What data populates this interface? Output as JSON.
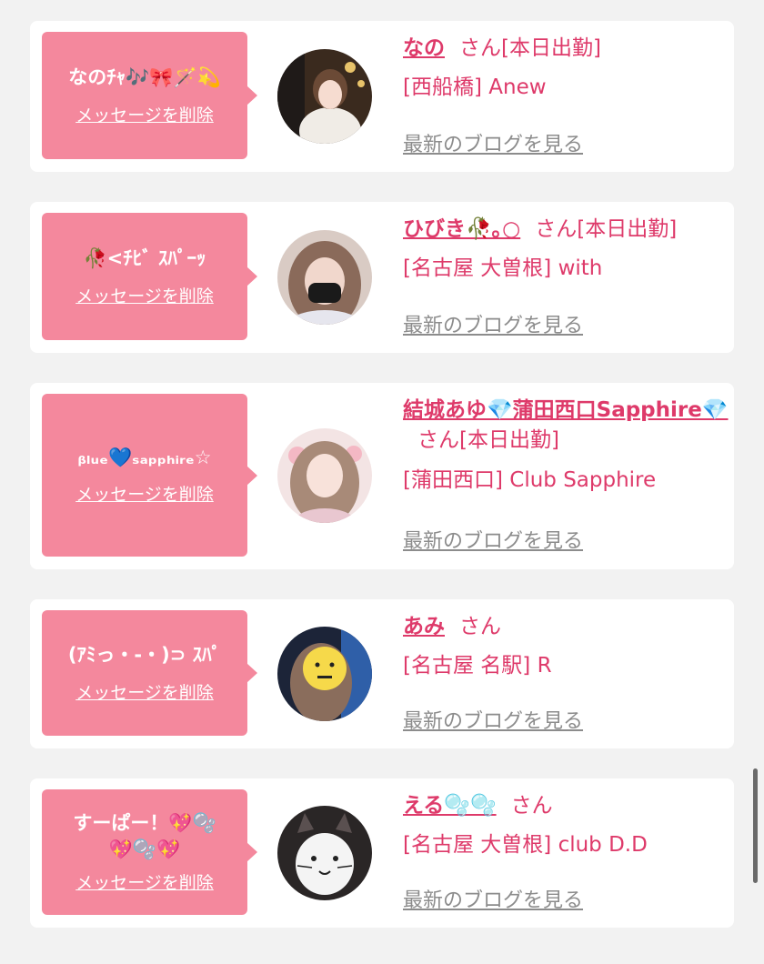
{
  "colors": {
    "background": "#f2f2f2",
    "card": "#ffffff",
    "bubble": "#f4889d",
    "accent": "#de3a6a",
    "muted": "#8c8c8c"
  },
  "entries": [
    {
      "message": "なのﾁｬ🎶🎀🪄💫",
      "delete_label": "メッセージを削除",
      "name": "なの",
      "san": "さん",
      "status": "[本日出勤]",
      "shop": "[西船橋] Anew",
      "blog_label": "最新のブログを見る"
    },
    {
      "message": "🥀<ﾁﾋﾞ ｽﾊﾟｰｯ",
      "delete_label": "メッセージを削除",
      "name": "ひびき🥀｡○",
      "san": "さん",
      "status": "[本日出勤]",
      "shop": "[名古屋 大曽根] with",
      "blog_label": "最新のブログを見る"
    },
    {
      "message": "ᵦₗᵤₑ💙ₛₐₚₚₕᵢᵣₑ☆",
      "delete_label": "メッセージを削除",
      "name": "結城あゆ💎蒲田西口Sapphire💎",
      "san": "さん",
      "status": "[本日出勤]",
      "shop": "[蒲田西口] Club Sapphire",
      "blog_label": "最新のブログを見る"
    },
    {
      "message": "(ｱﾐっ・-・)⊃ ｽﾊﾟ",
      "delete_label": "メッセージを削除",
      "name": "あみ",
      "san": "さん",
      "status": "",
      "shop": "[名古屋 名駅] R",
      "blog_label": "最新のブログを見る"
    },
    {
      "message": "すーぱー！💖🫧\n💖🫧💖",
      "delete_label": "メッセージを削除",
      "name": "える🫧🫧",
      "san": "さん",
      "status": "",
      "shop": "[名古屋 大曽根] club D.D",
      "blog_label": "最新のブログを見る"
    }
  ]
}
